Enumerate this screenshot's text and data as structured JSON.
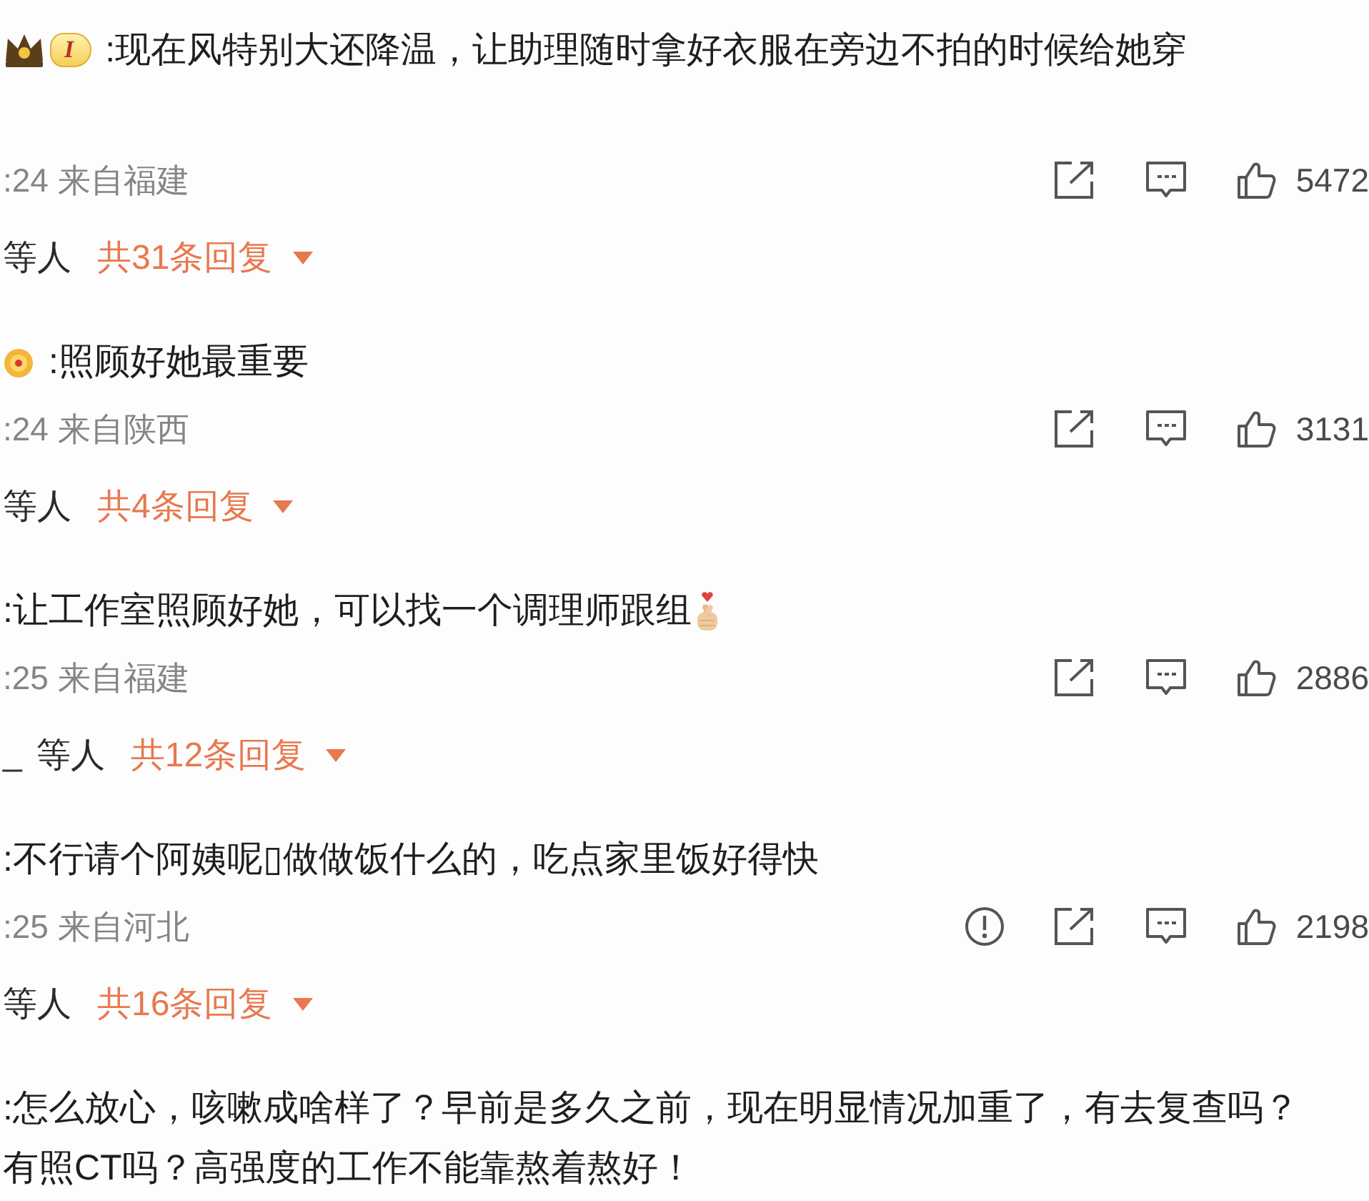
{
  "comments": [
    {
      "badges": [
        {
          "kind": "crown"
        },
        {
          "kind": "level",
          "label": "I"
        }
      ],
      "text": ":现在风特别大还降温，让助理随时拿好衣服在旁边不拍的时候给她穿",
      "meta": ":24 来自福建",
      "report": false,
      "likes": "5472",
      "replies": {
        "users": "等人",
        "count": "共31条回复"
      }
    },
    {
      "badges": [
        {
          "kind": "medal"
        }
      ],
      "text": ":照顾好她最重要",
      "meta": ":24 来自陕西",
      "report": false,
      "likes": "3131",
      "replies": {
        "users": "等人",
        "count": "共4条回复"
      }
    },
    {
      "text": ":让工作室照顾好她，可以找一个调理师跟组",
      "sticker": {
        "kind": "fingerheart"
      },
      "meta": ":25 来自福建",
      "report": false,
      "likes": "2886",
      "replies": {
        "name": "_",
        "users": "等人",
        "count": "共12条回复"
      }
    },
    {
      "text": ":不行请个阿姨呢▯做做饭什么的，吃点家里饭好得快",
      "meta": ":25 来自河北",
      "report": true,
      "likes": "2198",
      "replies": {
        "users": "等人",
        "count": "共16条回复"
      }
    },
    {
      "text": ":怎么放心，咳嗽成啥样了？早前是多久之前，现在明显情况加重了，有去复查吗？有照CT吗？高强度的工作不能靠熬着熬好！"
    }
  ]
}
